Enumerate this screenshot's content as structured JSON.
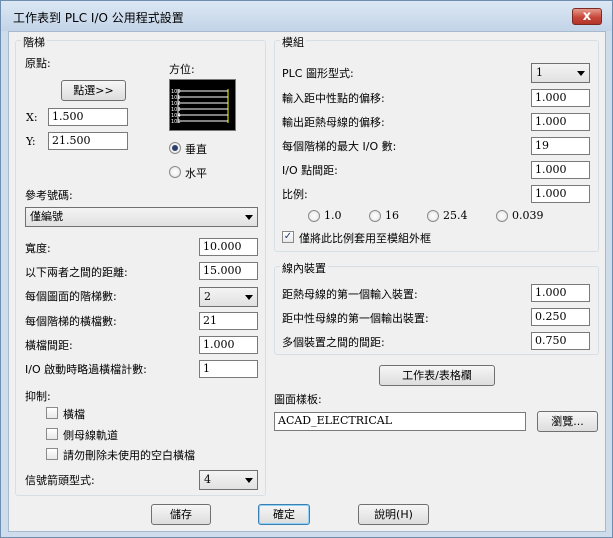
{
  "window": {
    "title": "工作表到 PLC I/O 公用程式設置",
    "close_glyph": "x"
  },
  "ladder": {
    "group_label": "階梯",
    "origin_label": "原點:",
    "pick_button": "點選>>",
    "x_label": "X:",
    "x_value": "1.500",
    "y_label": "Y:",
    "y_value": "21.500",
    "orientation_label": "方位:",
    "preview_rungs": [
      "100",
      "101",
      "102",
      "103",
      "104",
      "105"
    ],
    "vertical_label": "垂直",
    "horizontal_label": "水平",
    "ref_label": "參考號碼:",
    "ref_value": "僅編號",
    "width_label": "寬度:",
    "width_value": "10.000",
    "distance_label": "以下兩者之間的距離:",
    "distance_value": "15.000",
    "per_drawing_label": "每個圖面的階梯數:",
    "per_drawing_value": "2",
    "rungs_label": "每個階梯的橫檔數:",
    "rungs_value": "21",
    "spacing_label": "橫檔間距:",
    "spacing_value": "1.000",
    "skip_label": "I/O 啟動時略過橫檔計數:",
    "skip_value": "1",
    "suppress_label": "抑制:",
    "suppress_rungs": "橫檔",
    "suppress_rails": "側母線軌道",
    "suppress_blank": "請勿刪除未使用的空白橫檔",
    "arrow_label": "信號箭頭型式:",
    "arrow_value": "4"
  },
  "module": {
    "group_label": "模組",
    "plc_style_label": "PLC 圖形型式:",
    "plc_style_value": "1",
    "input_offset_label": "輸入距中性點的偏移:",
    "input_offset_value": "1.000",
    "output_offset_label": "輸出距熱母線的偏移:",
    "output_offset_value": "1.000",
    "max_io_label": "每個階梯的最大 I/O 數:",
    "max_io_value": "19",
    "io_spacing_label": "I/O 點間距:",
    "io_spacing_value": "1.000",
    "scale_label": "比例:",
    "scale_value": "1.000",
    "scale_options": [
      "1.0",
      "16",
      "25.4",
      "0.039"
    ],
    "scale_outside_label": "僅將此比例套用至模組外框"
  },
  "inline": {
    "group_label": "線內裝置",
    "first_input_label": "距熱母線的第一個輸入裝置:",
    "first_input_value": "1.000",
    "first_output_label": "距中性母線的第一個輸出裝置:",
    "first_output_value": "0.250",
    "between_label": "多個裝置之間的間距:",
    "between_value": "0.750"
  },
  "spreadsheet_button": "工作表/表格欄",
  "template": {
    "label": "圖面樣板:",
    "value": "ACAD_ELECTRICAL",
    "browse_button": "瀏覽..."
  },
  "footer": {
    "save": "儲存",
    "ok": "確定",
    "help": "說明(H)"
  }
}
